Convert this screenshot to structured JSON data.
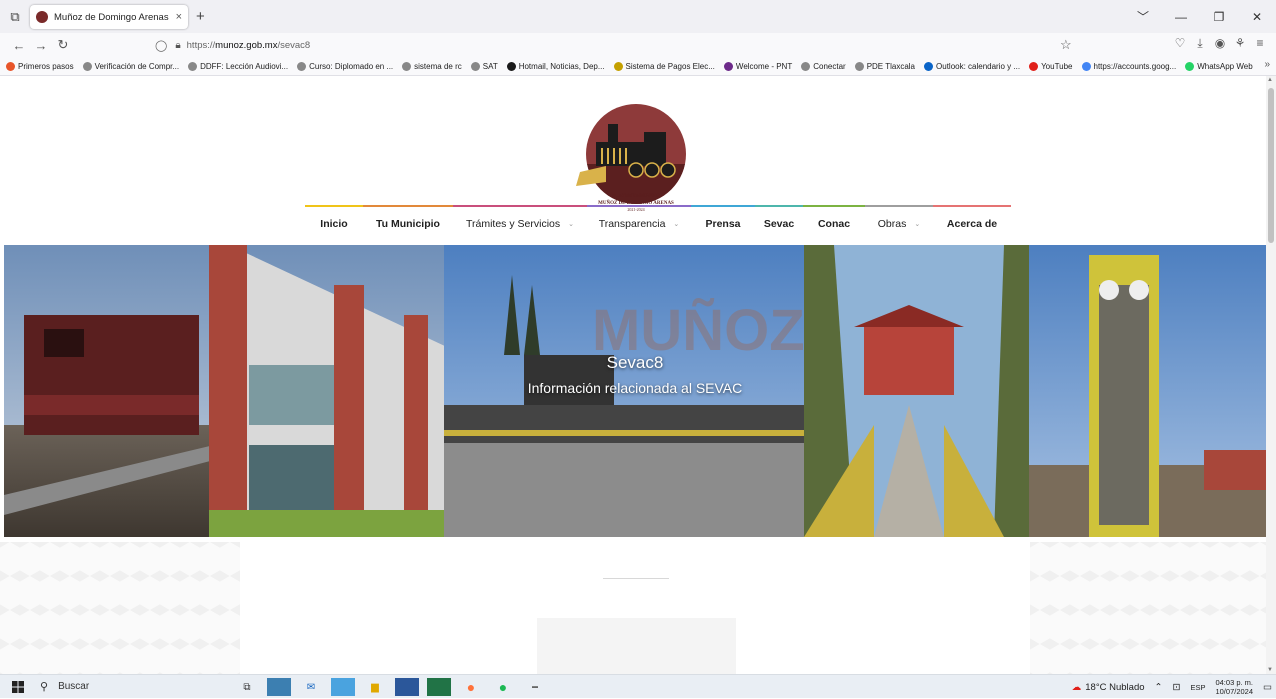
{
  "browser": {
    "tab": {
      "title": "Muñoz de Domingo Arenas",
      "close": "×"
    },
    "new_tab": "+",
    "window_controls": [
      "﹀",
      "—",
      "❐",
      "✕"
    ],
    "url": {
      "prefix": "https://",
      "domain": "munoz.gob.mx",
      "path": "/sevac8"
    },
    "bookmarks": [
      {
        "label": "Primeros pasos",
        "color": "#e8552a"
      },
      {
        "label": "Verificación de Compr...",
        "color": "#888888"
      },
      {
        "label": "DDFF: Lección Audiovi...",
        "color": "#888888"
      },
      {
        "label": "Curso: Diplomado en ...",
        "color": "#888888"
      },
      {
        "label": "sistema de rc",
        "color": "#888888"
      },
      {
        "label": "SAT",
        "color": "#888888"
      },
      {
        "label": "Hotmail, Noticias, Dep...",
        "color": "#1a1a1a"
      },
      {
        "label": "Sistema de Pagos Elec...",
        "color": "#c4a000"
      },
      {
        "label": "Welcome - PNT",
        "color": "#6d2a8a"
      },
      {
        "label": "Conectar",
        "color": "#888888"
      },
      {
        "label": "PDE Tlaxcala",
        "color": "#888888"
      },
      {
        "label": "Outlook: calendario y ...",
        "color": "#0a64c8"
      },
      {
        "label": "YouTube",
        "color": "#e0201a"
      },
      {
        "label": "https://accounts.goog...",
        "color": "#4285f4"
      },
      {
        "label": "WhatsApp Web",
        "color": "#25d366"
      }
    ],
    "bookmarks_more": "»"
  },
  "site": {
    "logo": {
      "line1": "H. AYUNTAMIENTO",
      "line2": "MUÑOZ DE DOMINGO ARENAS",
      "line3": "2021-2024"
    },
    "menu": [
      {
        "label": "Inicio",
        "bold": true,
        "caret": false,
        "color": "#f0c419",
        "width": 58
      },
      {
        "label": "Tu Municipio",
        "bold": true,
        "caret": false,
        "color": "#e2893a",
        "width": 90
      },
      {
        "label": "Trámites y Servicios",
        "bold": false,
        "caret": true,
        "color": "#c94f7c",
        "width": 134
      },
      {
        "label": "Transparencia",
        "bold": false,
        "caret": true,
        "color": "#8a6bc9",
        "width": 104
      },
      {
        "label": "Prensa",
        "bold": true,
        "caret": false,
        "color": "#3fa7d6",
        "width": 64
      },
      {
        "label": "Sevac",
        "bold": true,
        "caret": false,
        "color": "#4db6ac",
        "width": 48
      },
      {
        "label": "Conac",
        "bold": true,
        "caret": false,
        "color": "#7cb342",
        "width": 62
      },
      {
        "label": "Obras",
        "bold": false,
        "caret": true,
        "color": "#9e9e9e",
        "width": 68
      },
      {
        "label": "Acerca de",
        "bold": true,
        "caret": false,
        "color": "#e57373",
        "width": 78
      }
    ],
    "hero": {
      "watermark": "MUÑOZ",
      "title": "Sevac8",
      "subtitle": "Información relacionada al SEVAC"
    }
  },
  "taskbar": {
    "search_placeholder": "Buscar",
    "weather": "18°C  Nublado",
    "lang": "ESP",
    "time": "04:03 p. m.",
    "date": "10/07/2024"
  }
}
